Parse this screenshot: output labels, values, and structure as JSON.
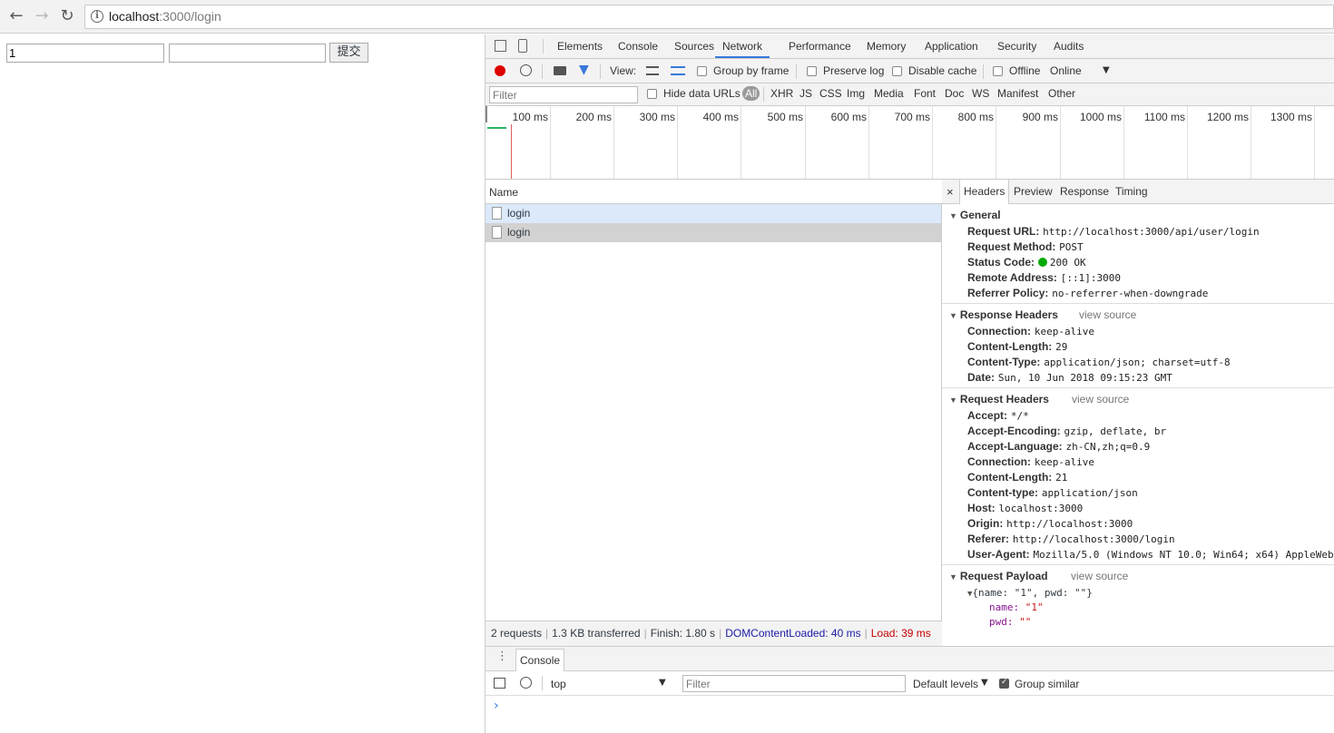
{
  "browser": {
    "url_host": "localhost",
    "url_path": ":3000/login"
  },
  "page": {
    "name_value": "1",
    "pwd_value": "",
    "submit_label": "提交"
  },
  "devtools": {
    "tabs": [
      "Elements",
      "Console",
      "Sources",
      "Network",
      "Performance",
      "Memory",
      "Application",
      "Security",
      "Audits"
    ],
    "active_tab": "Network",
    "toolbar": {
      "view_label": "View:",
      "group_by_frame": "Group by frame",
      "preserve_log": "Preserve log",
      "disable_cache": "Disable cache",
      "offline": "Offline",
      "throttle": "Online"
    },
    "filter": {
      "placeholder": "Filter",
      "hide_data_urls": "Hide data URLs",
      "types": [
        "All",
        "XHR",
        "JS",
        "CSS",
        "Img",
        "Media",
        "Font",
        "Doc",
        "WS",
        "Manifest",
        "Other"
      ]
    },
    "timeline_ticks": [
      "100 ms",
      "200 ms",
      "300 ms",
      "400 ms",
      "500 ms",
      "600 ms",
      "700 ms",
      "800 ms",
      "900 ms",
      "1000 ms",
      "1100 ms",
      "1200 ms",
      "1300 ms"
    ],
    "requests": {
      "column": "Name",
      "rows": [
        "login",
        "login"
      ]
    },
    "status": {
      "requests": "2 requests",
      "transferred": "1.3 KB transferred",
      "finish": "Finish: 1.80 s",
      "dcl": "DOMContentLoaded: 40 ms",
      "load": "Load: 39 ms",
      "dcl_color": "#1a1aa6",
      "load_color": "#c80000"
    },
    "detail_tabs": [
      "Headers",
      "Preview",
      "Response",
      "Timing"
    ],
    "general": {
      "title": "General",
      "rows": [
        {
          "k": "Request URL:",
          "v": "http://localhost:3000/api/user/login"
        },
        {
          "k": "Request Method:",
          "v": "POST"
        },
        {
          "k": "Status Code:",
          "v": "200 OK"
        },
        {
          "k": "Remote Address:",
          "v": "[::1]:3000"
        },
        {
          "k": "Referrer Policy:",
          "v": "no-referrer-when-downgrade"
        }
      ]
    },
    "response_headers": {
      "title": "Response Headers",
      "view_source": "view source",
      "rows": [
        {
          "k": "Connection:",
          "v": "keep-alive"
        },
        {
          "k": "Content-Length:",
          "v": "29"
        },
        {
          "k": "Content-Type:",
          "v": "application/json; charset=utf-8"
        },
        {
          "k": "Date:",
          "v": "Sun, 10 Jun 2018 09:15:23 GMT"
        }
      ]
    },
    "request_headers": {
      "title": "Request Headers",
      "view_source": "view source",
      "rows": [
        {
          "k": "Accept:",
          "v": "*/*"
        },
        {
          "k": "Accept-Encoding:",
          "v": "gzip, deflate, br"
        },
        {
          "k": "Accept-Language:",
          "v": "zh-CN,zh;q=0.9"
        },
        {
          "k": "Connection:",
          "v": "keep-alive"
        },
        {
          "k": "Content-Length:",
          "v": "21"
        },
        {
          "k": "Content-type:",
          "v": "application/json"
        },
        {
          "k": "Host:",
          "v": "localhost:3000"
        },
        {
          "k": "Origin:",
          "v": "http://localhost:3000"
        },
        {
          "k": "Referer:",
          "v": "http://localhost:3000/login"
        },
        {
          "k": "User-Agent:",
          "v": "Mozilla/5.0 (Windows NT 10.0; Win64; x64) AppleWebK"
        }
      ]
    },
    "payload": {
      "title": "Request Payload",
      "view_source": "view source",
      "summary": "{name: \"1\", pwd: \"\"}",
      "name_key": "name:",
      "name_val": "\"1\"",
      "pwd_key": "pwd:",
      "pwd_val": "\"\""
    },
    "drawer": {
      "tab": "Console",
      "context": "top",
      "filter_placeholder": "Filter",
      "levels": "Default levels",
      "group_similar": "Group similar",
      "prompt": "›"
    }
  }
}
